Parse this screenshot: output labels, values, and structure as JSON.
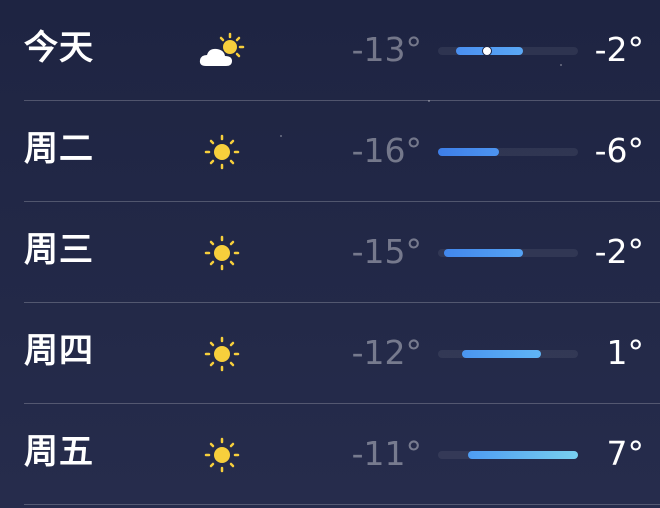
{
  "forecast": {
    "scale": {
      "min": -16,
      "max": 7
    },
    "days": [
      {
        "day": "今天",
        "icon": "partly-cloudy-icon",
        "low": "-13°",
        "high": "-2°",
        "low_value": -13,
        "high_value": -2,
        "current_value": -8,
        "gradient": [
          "#4a8ff0",
          "#5aa8f5"
        ]
      },
      {
        "day": "周二",
        "icon": "sun-icon",
        "low": "-16°",
        "high": "-6°",
        "low_value": -16,
        "high_value": -6,
        "gradient": [
          "#3d7ee8",
          "#4d94f0"
        ]
      },
      {
        "day": "周三",
        "icon": "sun-icon",
        "low": "-15°",
        "high": "-2°",
        "low_value": -15,
        "high_value": -2,
        "gradient": [
          "#4287ec",
          "#55a3f4"
        ]
      },
      {
        "day": "周四",
        "icon": "sun-icon",
        "low": "-12°",
        "high": "1°",
        "low_value": -12,
        "high_value": 1,
        "gradient": [
          "#4a95f0",
          "#60b5f5"
        ]
      },
      {
        "day": "周五",
        "icon": "sun-icon",
        "low": "-11°",
        "high": "7°",
        "low_value": -11,
        "high_value": 7,
        "gradient": [
          "#4e9cf2",
          "#78d0f0"
        ]
      }
    ]
  },
  "colors": {
    "sun": "#f7cf3c",
    "cloud": "#ffffff"
  }
}
